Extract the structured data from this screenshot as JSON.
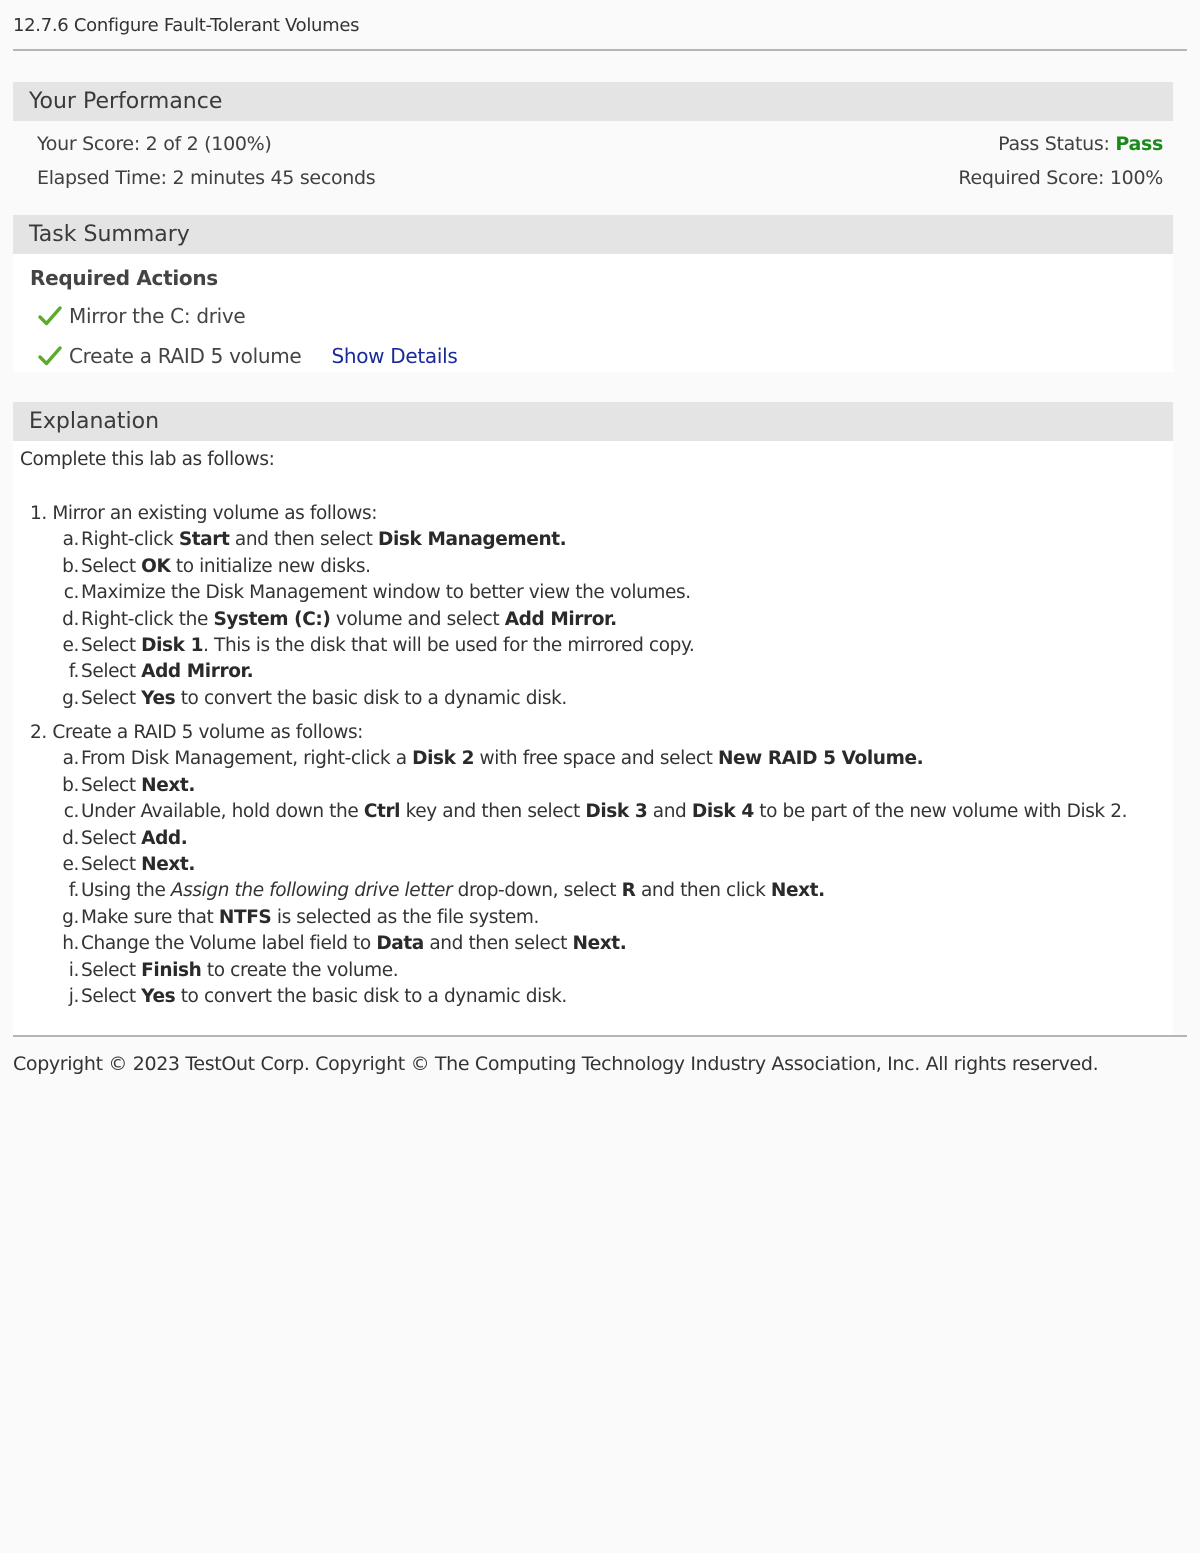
{
  "lab_title": "12.7.6 Configure Fault-Tolerant Volumes",
  "performance": {
    "heading": "Your Performance",
    "score_label": "Your Score:",
    "score_value": "2 of 2 (100%)",
    "elapsed_label": "Elapsed Time:",
    "elapsed_value": "2 minutes 45 seconds",
    "pass_status_label": "Pass Status:",
    "pass_status_value": "Pass",
    "required_score_label": "Required Score:",
    "required_score_value": "100%",
    "colors": {
      "pass": "#1a8a1a"
    }
  },
  "task_summary": {
    "heading": "Task Summary",
    "required_actions_label": "Required Actions",
    "actions": [
      {
        "label": "Mirror the C: drive",
        "icon": "check-icon"
      },
      {
        "label": "Create a RAID 5 volume",
        "icon": "check-icon"
      }
    ],
    "show_details_label": "Show Details"
  },
  "explanation": {
    "heading": "Explanation",
    "intro": "Complete this lab as follows:",
    "steps": [
      {
        "number": "1.",
        "text": "Mirror an existing volume as follows:",
        "substeps": [
          {
            "letter": "a.",
            "parts": [
              "Right-click ",
              "Start",
              " and then select ",
              "Disk Management."
            ]
          },
          {
            "letter": "b.",
            "parts": [
              "Select ",
              "OK",
              " to initialize new disks."
            ]
          },
          {
            "letter": "c.",
            "parts": [
              "Maximize the Disk Management window to better view the volumes."
            ]
          },
          {
            "letter": "d.",
            "parts": [
              "Right-click the ",
              "System (C:)",
              " volume and select ",
              "Add Mirror."
            ]
          },
          {
            "letter": "e.",
            "parts": [
              "Select ",
              "Disk 1",
              ". This is the disk that will be used for the mirrored copy."
            ]
          },
          {
            "letter": "f.",
            "parts": [
              "Select ",
              "Add Mirror."
            ]
          },
          {
            "letter": "g.",
            "parts": [
              "Select ",
              "Yes",
              " to convert the basic disk to a dynamic disk."
            ]
          }
        ]
      },
      {
        "number": "2.",
        "text": "Create a RAID 5 volume as follows:",
        "substeps": [
          {
            "letter": "a.",
            "parts": [
              "From Disk Management, right-click a ",
              "Disk 2",
              " with free space and select ",
              "New RAID 5 Volume."
            ]
          },
          {
            "letter": "b.",
            "parts": [
              "Select ",
              "Next."
            ]
          },
          {
            "letter": "c.",
            "parts": [
              "Under Available, hold down the ",
              "Ctrl",
              " key and then select ",
              "Disk 3",
              " and ",
              "Disk 4",
              " to be part of the new volume with Disk 2."
            ]
          },
          {
            "letter": "d.",
            "parts": [
              "Select ",
              "Add."
            ]
          },
          {
            "letter": "e.",
            "parts": [
              "Select ",
              "Next."
            ]
          },
          {
            "letter": "f.",
            "parts": [
              "Using the ",
              "Assign the following drive letter",
              " drop-down, select ",
              "R",
              " and then click ",
              "Next."
            ]
          },
          {
            "letter": "g.",
            "parts": [
              "Make sure that ",
              "NTFS",
              " is selected as the file system."
            ]
          },
          {
            "letter": "h.",
            "parts": [
              "Change the Volume label field to ",
              "Data",
              " and then select ",
              "Next."
            ]
          },
          {
            "letter": "i.",
            "parts": [
              "Select ",
              "Finish",
              " to create the volume."
            ]
          },
          {
            "letter": "j.",
            "parts": [
              "Select ",
              "Yes",
              " to convert the basic disk to a dynamic disk."
            ]
          }
        ]
      }
    ]
  },
  "footer": {
    "copyright": "Copyright © 2023 TestOut Corp. Copyright © The Computing Technology Industry Association, Inc. All rights reserved."
  }
}
